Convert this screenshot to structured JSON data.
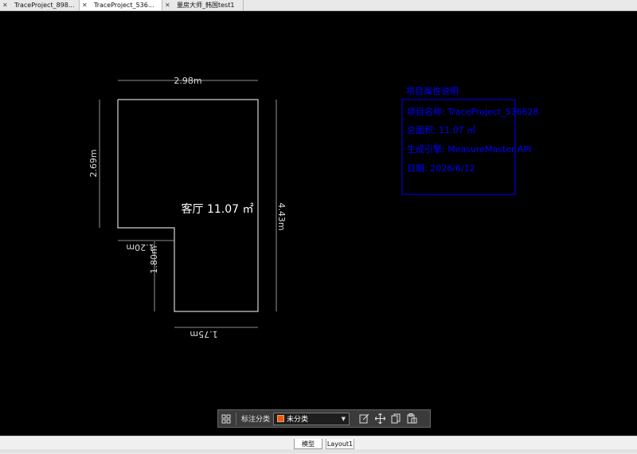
{
  "tabs": [
    {
      "label": "TraceProject_898...",
      "active": false
    },
    {
      "label": "TraceProject_536...",
      "active": true
    },
    {
      "label": "量房大师_韩国test1",
      "active": false
    }
  ],
  "drawing": {
    "room_label": "客厅 11.07 ㎡",
    "dimensions": {
      "top": "2.98m",
      "left": "2.69m",
      "right": "4.43m",
      "notch_horizontal": "1.20m",
      "notch_vertical": "1.80m",
      "bottom": "1.75m"
    },
    "info_box": {
      "title": "项目属性说明",
      "lines": [
        "项目名称: TraceProject_536628",
        "总面积: 11.07 ㎡",
        "生成引擎: MeasureMaster API",
        "日期: 2026/6/12"
      ]
    },
    "colors": {
      "lines": "#ffffff",
      "info": "#0000ff",
      "background": "#000000"
    }
  },
  "toolbar": {
    "label": "标注分类",
    "category_value": "未分类",
    "category_color": "#e85a12"
  },
  "bottom_tabs": {
    "model": "模型",
    "layout": "Layout1"
  }
}
